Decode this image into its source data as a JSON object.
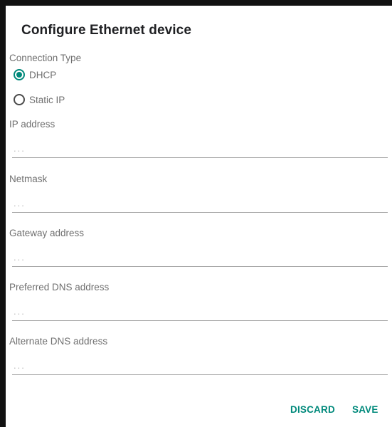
{
  "dialog": {
    "title": "Configure Ethernet device",
    "connection_type_label": "Connection Type",
    "options": [
      {
        "label": "DHCP",
        "selected": true
      },
      {
        "label": "Static IP",
        "selected": false
      }
    ],
    "fields": [
      {
        "label": "IP address",
        "placeholder": "...",
        "value": ""
      },
      {
        "label": "Netmask",
        "placeholder": "...",
        "value": ""
      },
      {
        "label": "Gateway address",
        "placeholder": "...",
        "value": ""
      },
      {
        "label": "Preferred DNS address",
        "placeholder": "...",
        "value": ""
      },
      {
        "label": "Alternate DNS address",
        "placeholder": "...",
        "value": ""
      }
    ],
    "buttons": {
      "discard": "DISCARD",
      "save": "SAVE"
    }
  },
  "colors": {
    "accent": "#00897b",
    "background": "#ffffff",
    "frame": "#111111"
  }
}
